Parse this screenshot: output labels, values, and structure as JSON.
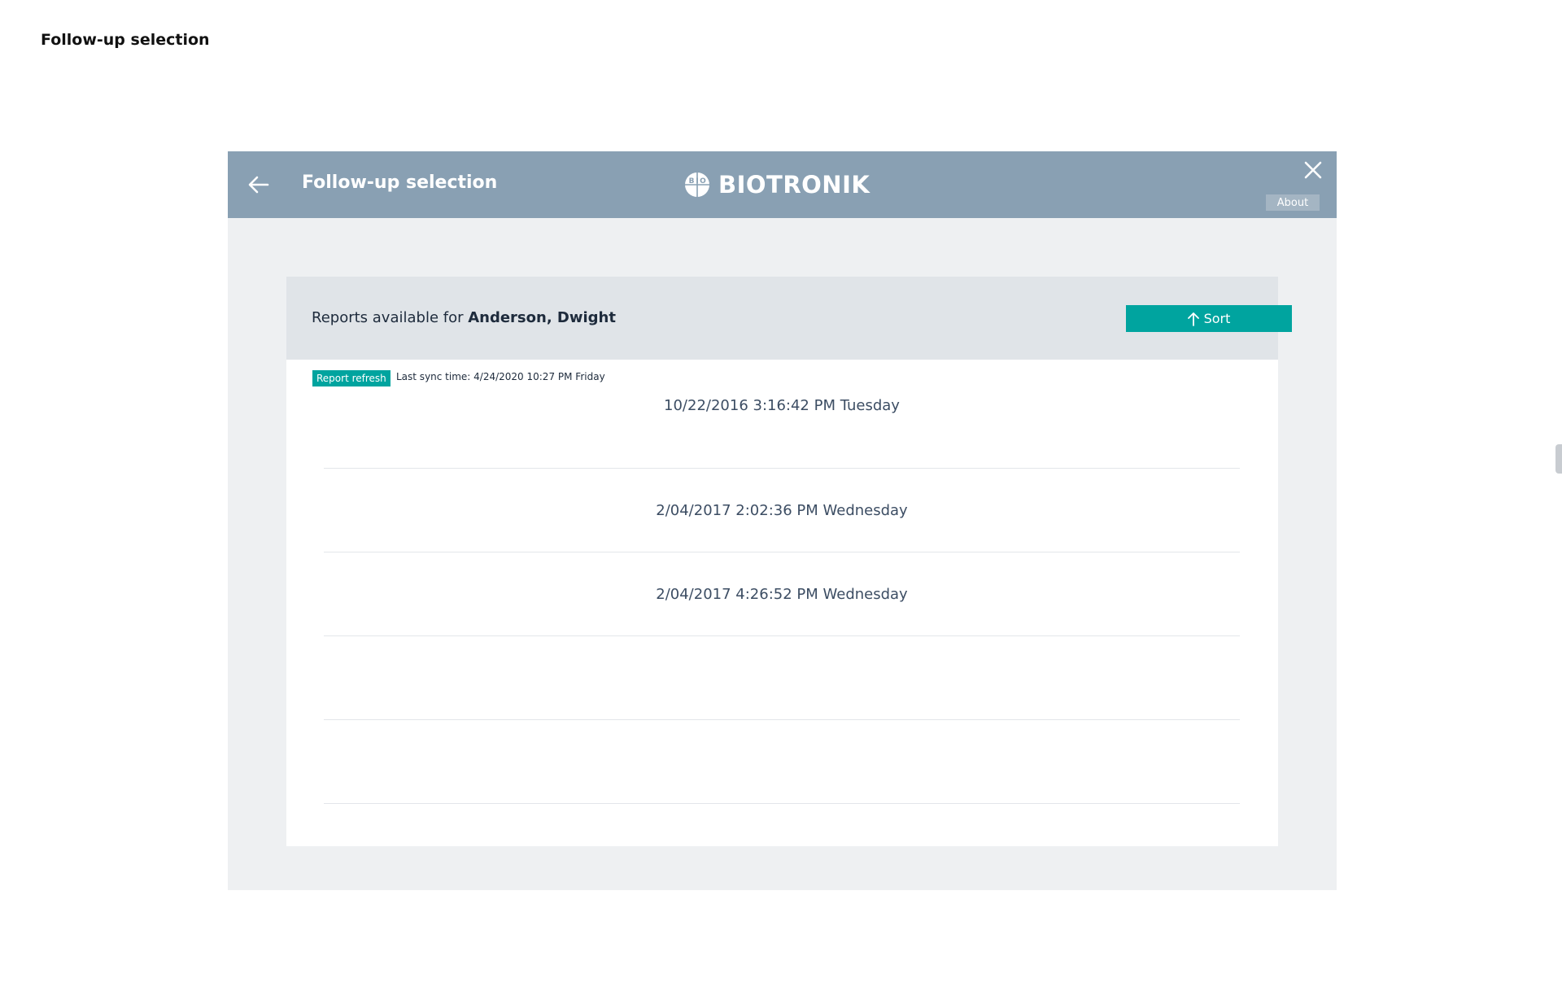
{
  "page": {
    "heading": "Follow-up selection"
  },
  "dialog": {
    "title": "Follow-up selection",
    "brand_name": "BIOTRONIK",
    "about_label": "About"
  },
  "reports": {
    "label_prefix": "Reports available for ",
    "patient_name": "Anderson, Dwight",
    "sort_label": "Sort",
    "refresh_label": "Report refresh",
    "last_sync": "Last sync time: 4/24/2020 10:27 PM Friday",
    "items": [
      "10/22/2016 3:16:42 PM Tuesday",
      "2/04/2017 2:02:36 PM Wednesday",
      "2/04/2017 4:26:52 PM Wednesday",
      "",
      ""
    ]
  },
  "colors": {
    "header_bg": "#89a0b3",
    "accent": "#00a49f",
    "dialog_bg": "#eef0f2",
    "card_header_bg": "#e0e4e8"
  },
  "icons": {
    "back": "arrow-left-icon",
    "close": "close-icon",
    "sort": "arrow-up-icon",
    "brand": "biotronik-logo"
  }
}
